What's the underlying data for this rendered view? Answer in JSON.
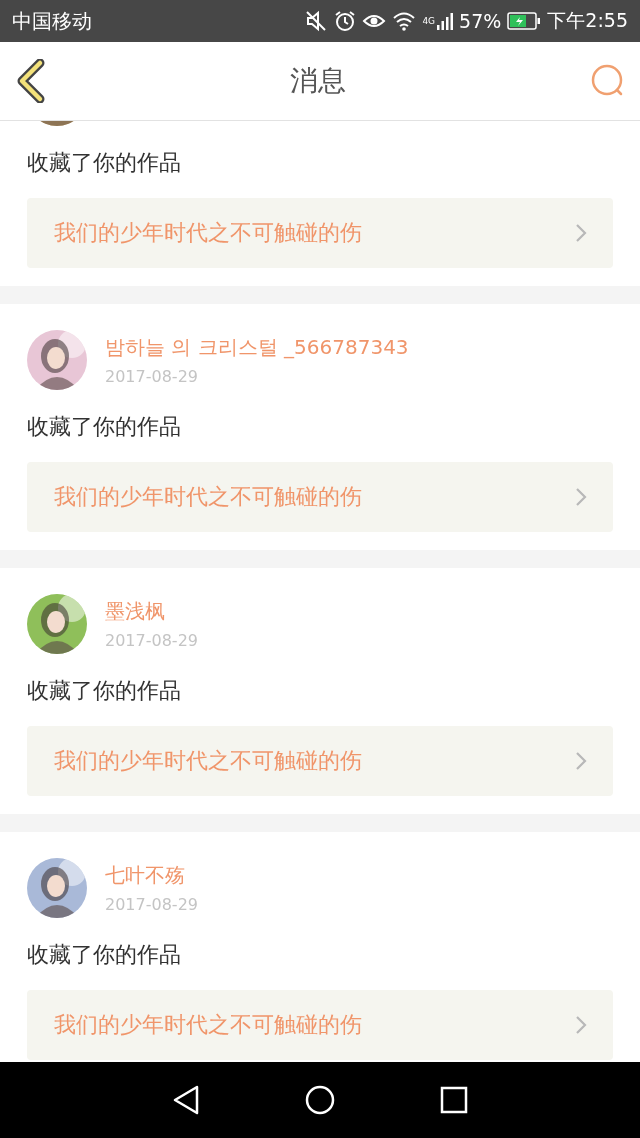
{
  "status_bar": {
    "carrier": "中国移动",
    "network": "4G",
    "battery": "57%",
    "time": "下午2:55"
  },
  "header": {
    "title": "消息"
  },
  "messages": [
    {
      "action": "收藏了你的作品",
      "work": "我们的少年时代之不可触碰的伤"
    },
    {
      "name": "밤하늘 의 크리스털 _566787343",
      "date": "2017-08-29",
      "action": "收藏了你的作品",
      "work": "我们的少年时代之不可触碰的伤"
    },
    {
      "name": "墨浅枫",
      "date": "2017-08-29",
      "action": "收藏了你的作品",
      "work": "我们的少年时代之不可触碰的伤"
    },
    {
      "name": "七叶不殇",
      "date": "2017-08-29",
      "action": "收藏了你的作品",
      "work": "我们的少年时代之不可触碰的伤"
    }
  ]
}
